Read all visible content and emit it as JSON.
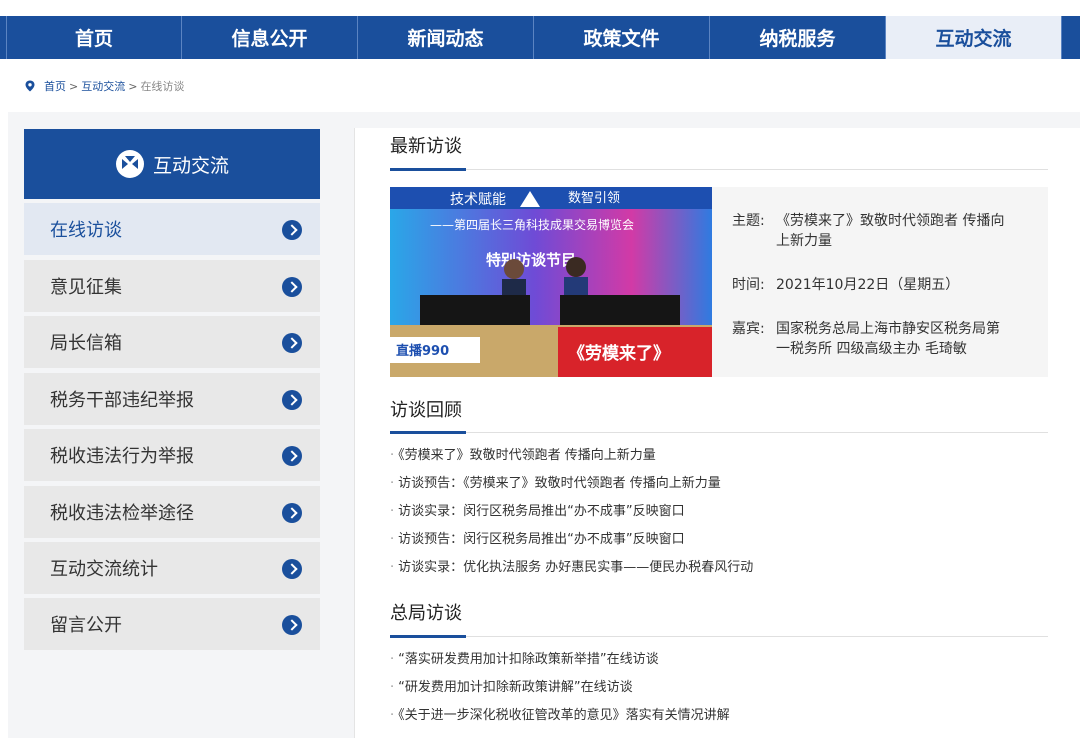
{
  "nav": {
    "items": [
      {
        "label": "首页"
      },
      {
        "label": "信息公开"
      },
      {
        "label": "新闻动态"
      },
      {
        "label": "政策文件"
      },
      {
        "label": "纳税服务"
      },
      {
        "label": "互动交流"
      }
    ],
    "active_index": 5
  },
  "breadcrumb": {
    "home": "首页",
    "section": "互动交流",
    "current": "在线访谈",
    "separator": ">"
  },
  "sidebar": {
    "title": "互动交流",
    "items": [
      {
        "label": "在线访谈"
      },
      {
        "label": "意见征集"
      },
      {
        "label": "局长信箱"
      },
      {
        "label": "税务干部违纪举报"
      },
      {
        "label": "税收违法行为举报"
      },
      {
        "label": "税收违法检举途径"
      },
      {
        "label": "互动交流统计"
      },
      {
        "label": "留言公开"
      }
    ],
    "active_index": 0
  },
  "latest": {
    "heading": "最新访谈",
    "photo": {
      "banner_line1": "技术赋能",
      "banner_line2": "数智引领",
      "banner_line3": "——第四届长三角科技成果交易博览会",
      "banner_line4": "特别访谈节目",
      "desk_sign": "《劳模来了》",
      "channel": "直播990"
    },
    "topic_key": "主题:",
    "topic_value": "《劳模来了》致敬时代领跑者 传播向上新力量",
    "time_key": "时间:",
    "time_value": "2021年10月22日（星期五）",
    "guest_key": "嘉宾:",
    "guest_value": "国家税务总局上海市静安区税务局第一税务所 四级高级主办 毛琦敏"
  },
  "review": {
    "heading": "访谈回顾",
    "items": [
      "《劳模来了》致敬时代领跑者 传播向上新力量",
      "访谈预告：《劳模来了》致敬时代领跑者 传播向上新力量",
      "访谈实录：闵行区税务局推出“办不成事”反映窗口",
      "访谈预告：闵行区税务局推出“办不成事”反映窗口",
      "访谈实录：优化执法服务 办好惠民实事——便民办税春风行动"
    ]
  },
  "hq": {
    "heading": "总局访谈",
    "items": [
      "“落实研发费用加计扣除政策新举措”在线访谈",
      "“研发费用加计扣除新政策讲解”在线访谈",
      "《关于进一步深化税收征管改革的意见》落实有关情况讲解"
    ]
  },
  "colors": {
    "primary": "#1a4f9c",
    "nav_active_bg": "#e9eef7",
    "sidebar_item_bg": "#e8e8e8",
    "page_bg": "#f4f5f7"
  }
}
